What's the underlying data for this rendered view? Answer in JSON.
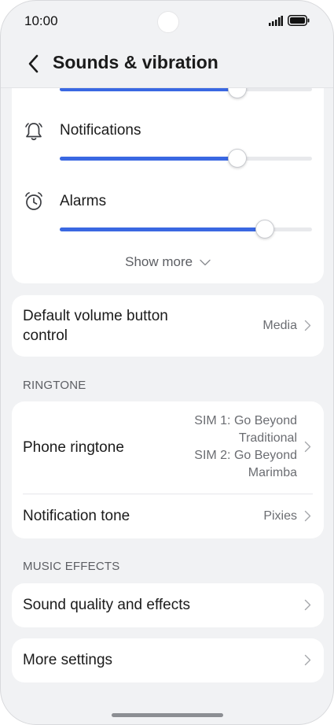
{
  "status_bar": {
    "time": "10:00"
  },
  "header": {
    "title": "Sounds & vibration"
  },
  "volume": {
    "first_level": 0.7,
    "items": [
      {
        "label": "Notifications",
        "icon": "bell-icon",
        "level": 0.7
      },
      {
        "label": "Alarms",
        "icon": "alarm-clock-icon",
        "level": 0.81
      }
    ],
    "show_more_label": "Show more"
  },
  "default_volume": {
    "label": "Default volume button control",
    "value": "Media"
  },
  "ringtone_section": {
    "title": "RINGTONE",
    "phone_ringtone": {
      "label": "Phone ringtone",
      "sim1_line1": "SIM 1: Go Beyond",
      "sim1_line2": "Traditional",
      "sim2_line1": "SIM 2: Go Beyond",
      "sim2_line2": "Marimba"
    },
    "notification_tone": {
      "label": "Notification tone",
      "value": "Pixies"
    }
  },
  "music_section": {
    "title": "MUSIC EFFECTS",
    "sound_quality": {
      "label": "Sound quality and effects"
    }
  },
  "more_settings": {
    "label": "More settings"
  },
  "colors": {
    "accent": "#3a68e2",
    "background": "#f1f2f4",
    "card": "#ffffff"
  }
}
